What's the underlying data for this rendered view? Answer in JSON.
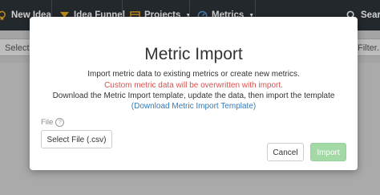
{
  "navbar": {
    "items": [
      {
        "label": "New Idea",
        "icon": "lightbulb-icon"
      },
      {
        "label": "Idea Funnel",
        "icon": "funnel-icon"
      },
      {
        "label": "Projects",
        "icon": "projects-icon",
        "dropdown": true
      },
      {
        "label": "Metrics",
        "icon": "metrics-icon",
        "dropdown": true
      },
      {
        "label": "Search",
        "icon": "search-icon"
      }
    ],
    "background": "#2b3137"
  },
  "background_page": {
    "select_placeholder": "Select",
    "filter_placeholder": "Filter..."
  },
  "modal": {
    "title": "Metric Import",
    "description": "Import metric data to existing metrics or create new metrics.",
    "warning": "Custom metric data will be overwritten with import.",
    "instructions": "Download the Metric Import template, update the data, then import the template",
    "template_link_open": "(",
    "template_link": "Download Metric Import Template",
    "template_link_close": ")",
    "file_label": "File",
    "file_help_icon": "question-circle-icon",
    "select_file_label": "Select File (.csv)",
    "cancel_label": "Cancel",
    "import_label": "Import",
    "colors": {
      "warning": "#d9534f",
      "link": "#337ab7",
      "import_button": "#a3d9a5"
    }
  }
}
